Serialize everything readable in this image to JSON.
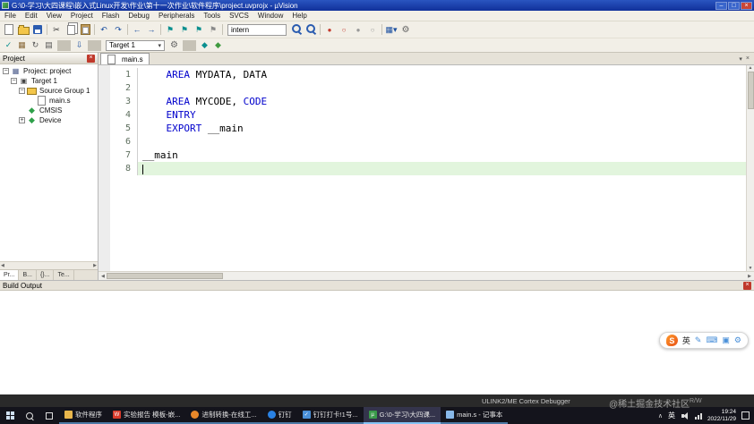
{
  "window": {
    "title": "G:\\0-学习\\大四课程\\嵌入式Linux开发\\作业\\第十一次作业\\软件程序\\project.uvprojx - µVision",
    "controls": {
      "minimize": "–",
      "maximize": "□",
      "close": "×"
    }
  },
  "menubar": {
    "items": [
      "File",
      "Edit",
      "View",
      "Project",
      "Flash",
      "Debug",
      "Peripherals",
      "Tools",
      "SVCS",
      "Window",
      "Help"
    ]
  },
  "icons": {
    "combo_arrow": "▾",
    "chevron_down": "▾",
    "close_x": "×",
    "up_arrow": "▲",
    "down_arrow": "▼",
    "left_arrow": "◀",
    "right_arrow": "▶",
    "tray_chevron": "∧"
  },
  "toolbar1": {
    "search_value": "intern",
    "buttons_a": [
      {
        "name": "new-file-button",
        "icon": "new-file",
        "glyph": "",
        "it": "true"
      },
      {
        "name": "open-file-button",
        "icon": "open-folder",
        "glyph": "",
        "it": "true"
      },
      {
        "name": "save-button",
        "icon": "save",
        "glyph": "",
        "it": "true"
      },
      {
        "name": "toolbar-separator",
        "icon": "sep",
        "glyph": "",
        "it": "false"
      },
      {
        "name": "cut-button",
        "icon": "cut",
        "glyph": "✂",
        "it": "true"
      },
      {
        "name": "copy-button",
        "icon": "copy",
        "glyph": "",
        "it": "true"
      },
      {
        "name": "paste-button",
        "icon": "paste",
        "glyph": "",
        "it": "true"
      },
      {
        "name": "toolbar-separator",
        "icon": "sep",
        "glyph": "",
        "it": "false"
      },
      {
        "name": "undo-button",
        "icon": "undo",
        "glyph": "↶",
        "it": "true"
      },
      {
        "name": "redo-button",
        "icon": "redo",
        "glyph": "↷",
        "it": "true"
      },
      {
        "name": "toolbar-separator",
        "icon": "sep",
        "glyph": "",
        "it": "false"
      },
      {
        "name": "navigate-back-button",
        "icon": "nav-back",
        "glyph": "←",
        "it": "true"
      },
      {
        "name": "navigate-forward-button",
        "icon": "nav-forward",
        "glyph": "→",
        "it": "true"
      },
      {
        "name": "toolbar-separator",
        "icon": "sep",
        "glyph": "",
        "it": "false"
      },
      {
        "name": "bookmark-toggle-button",
        "icon": "bookmark",
        "glyph": "⚑",
        "it": "true"
      },
      {
        "name": "bookmark-prev-button",
        "icon": "bookmark-prev",
        "glyph": "⚑",
        "it": "true"
      },
      {
        "name": "bookmark-next-button",
        "icon": "bookmark-next",
        "glyph": "⚑",
        "it": "true"
      },
      {
        "name": "bookmark-clear-button",
        "icon": "bookmark-clear",
        "glyph": "⚑",
        "it": "true"
      },
      {
        "name": "toolbar-separator",
        "icon": "sep",
        "glyph": "",
        "it": "false"
      }
    ],
    "buttons_b": [
      {
        "name": "find-button",
        "icon": "find",
        "glyph": "",
        "it": "true"
      },
      {
        "name": "find-in-files-button",
        "icon": "find-in-files",
        "glyph": "",
        "it": "true"
      },
      {
        "name": "toolbar-separator",
        "icon": "sep",
        "glyph": "",
        "it": "false"
      },
      {
        "name": "insert-breakpoint-button",
        "icon": "breakpoint",
        "glyph": "●",
        "it": "true"
      },
      {
        "name": "disable-breakpoint-button",
        "icon": "breakpoint-disable",
        "glyph": "○",
        "it": "true"
      },
      {
        "name": "disable-all-breakpoints-button",
        "icon": "breakpoint-disable-all",
        "glyph": "●",
        "it": "true"
      },
      {
        "name": "kill-all-breakpoints-button",
        "icon": "breakpoint-kill",
        "glyph": "○",
        "it": "true"
      },
      {
        "name": "toolbar-separator",
        "icon": "sep",
        "glyph": "",
        "it": "false"
      },
      {
        "name": "window-layout-button",
        "icon": "window-layout",
        "glyph": "▦▾",
        "it": "true"
      },
      {
        "name": "configure-button",
        "icon": "configure",
        "glyph": "⚙",
        "it": "true"
      }
    ]
  },
  "toolbar2": {
    "target_value": "Target 1",
    "buttons_a": [
      {
        "name": "translate-button",
        "icon": "translate",
        "glyph": "✓",
        "it": "true"
      },
      {
        "name": "build-button",
        "icon": "build",
        "glyph": "▦",
        "it": "true"
      },
      {
        "name": "rebuild-button",
        "icon": "rebuild",
        "glyph": "↻",
        "it": "true"
      },
      {
        "name": "batch-build-button",
        "icon": "batch-build",
        "glyph": "▤",
        "it": "true"
      },
      {
        "name": "toolbar-separator",
        "icon": "sep",
        "glyph": "",
        "it": "false"
      },
      {
        "name": "download-button",
        "icon": "download",
        "glyph": "⇩",
        "it": "true"
      },
      {
        "name": "toolbar-separator",
        "icon": "sep",
        "glyph": "",
        "it": "false"
      }
    ],
    "buttons_b": [
      {
        "name": "target-options-button",
        "icon": "target-options",
        "glyph": "⚙",
        "it": "true"
      },
      {
        "name": "toolbar-separator",
        "icon": "sep",
        "glyph": "",
        "it": "false"
      },
      {
        "name": "manage-rte-button",
        "icon": "manage-rte",
        "glyph": "◆",
        "it": "true"
      },
      {
        "name": "manage-packs-button",
        "icon": "manage-packs",
        "glyph": "◆",
        "it": "true"
      }
    ]
  },
  "project_panel": {
    "title": "Project",
    "tree": [
      {
        "name": "tree-item-project",
        "indent": "0",
        "expand": "−",
        "icon": "project",
        "glyph": "▦",
        "label": "Project: project"
      },
      {
        "name": "tree-item-target1",
        "indent": "1",
        "expand": "−",
        "icon": "target",
        "glyph": "▣",
        "label": "Target 1"
      },
      {
        "name": "tree-item-source-group",
        "indent": "2",
        "expand": "−",
        "icon": "folder",
        "glyph": "",
        "label": "Source Group 1"
      },
      {
        "name": "tree-item-main-s",
        "indent": "3",
        "expand": "",
        "icon": "file",
        "glyph": "",
        "label": "main.s"
      },
      {
        "name": "tree-item-cmsis",
        "indent": "2",
        "expand": "",
        "icon": "component",
        "glyph": "◆",
        "label": "CMSIS"
      },
      {
        "name": "tree-item-device",
        "indent": "2",
        "expand": "+",
        "icon": "component",
        "glyph": "◆",
        "label": "Device"
      }
    ],
    "tabs": [
      {
        "name": "panel-tab-project",
        "label": "Pr...",
        "state": "active"
      },
      {
        "name": "panel-tab-books",
        "label": "B...",
        "state": ""
      },
      {
        "name": "panel-tab-functions",
        "label": "{}...",
        "state": ""
      },
      {
        "name": "panel-tab-templates",
        "label": "Te...",
        "state": ""
      }
    ]
  },
  "editor": {
    "tab": "main.s",
    "lines": [
      {
        "num": "1",
        "tokens": [
          [
            "    ",
            "p"
          ],
          [
            "AREA",
            "k"
          ],
          [
            " MYDATA, DATA",
            "p"
          ]
        ]
      },
      {
        "num": "2",
        "tokens": []
      },
      {
        "num": "3",
        "tokens": [
          [
            "    ",
            "p"
          ],
          [
            "AREA",
            "k"
          ],
          [
            " MYCODE, ",
            "p"
          ],
          [
            "CODE",
            "k"
          ]
        ]
      },
      {
        "num": "4",
        "tokens": [
          [
            "    ",
            "p"
          ],
          [
            "ENTRY",
            "k"
          ]
        ]
      },
      {
        "num": "5",
        "tokens": [
          [
            "    ",
            "p"
          ],
          [
            "EXPORT",
            "k"
          ],
          [
            " __main",
            "p"
          ]
        ]
      },
      {
        "num": "6",
        "tokens": []
      },
      {
        "num": "7",
        "tokens": [
          [
            "__main",
            "p"
          ]
        ]
      },
      {
        "num": "8",
        "tokens": [],
        "current": true,
        "caret": true
      }
    ]
  },
  "build_output": {
    "title": "Build Output"
  },
  "status": {
    "debugger": "ULINK2/ME Cortex Debugger",
    "watermark": "@稀土掘金技术社区",
    "rw": "R/W"
  },
  "ime": {
    "logo": "S",
    "mode": "英",
    "tools": [
      {
        "name": "handwriting-icon",
        "glyph": "✎"
      },
      {
        "name": "keyboard-icon",
        "glyph": "⌨"
      },
      {
        "name": "skin-icon",
        "glyph": "▣"
      },
      {
        "name": "toolbox-icon",
        "glyph": "⚙"
      }
    ]
  },
  "taskbar": {
    "items": [
      {
        "name": "taskbar-item-explorer",
        "icon": "folder",
        "ig": "",
        "label": "软件程序",
        "state": ""
      },
      {
        "name": "taskbar-item-wps",
        "icon": "wps",
        "ig": "W",
        "label": "实验报告 模板-嵌...",
        "state": ""
      },
      {
        "name": "taskbar-item-browser",
        "icon": "browser",
        "ig": "",
        "label": "进制转换-在线工...",
        "state": ""
      },
      {
        "name": "taskbar-item-dingtalk",
        "icon": "dingtalk",
        "ig": "",
        "label": "钉钉",
        "state": ""
      },
      {
        "name": "taskbar-item-dingtalk-note",
        "icon": "note",
        "ig": "✓",
        "label": "钉钉打卡!1号...",
        "state": ""
      },
      {
        "name": "taskbar-item-uvision",
        "icon": "uvision",
        "ig": "µ",
        "label": "G:\\0-学习\\大四课...",
        "state": "active"
      },
      {
        "name": "taskbar-item-notepad",
        "icon": "notepad",
        "ig": "",
        "label": "main.s - 记事本",
        "state": ""
      }
    ],
    "tray": {
      "ime": "英",
      "time": "19:24",
      "date": "2022/11/29"
    }
  }
}
